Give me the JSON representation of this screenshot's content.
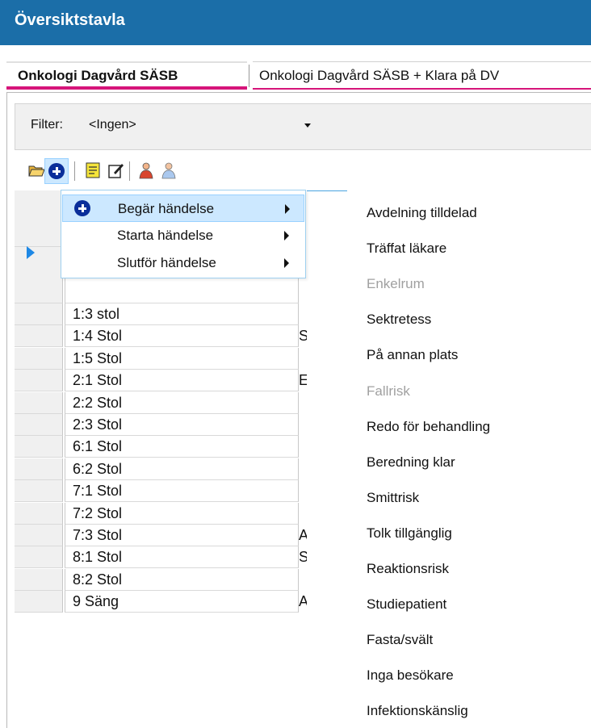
{
  "window": {
    "title": "Översiktstavla"
  },
  "tabs": [
    {
      "label": "Onkologi Dagvård SÄSB",
      "active": true
    },
    {
      "label": "Onkologi Dagvård SÄSB + Klara på DV",
      "active": false
    }
  ],
  "filter": {
    "label": "Filter:",
    "value": "<Ingen>"
  },
  "toolbar": {
    "icons": [
      "open-folder-icon",
      "add-event-icon",
      "note-icon",
      "edit-icon",
      "person-red-icon",
      "person-blue-icon"
    ]
  },
  "context_menu": {
    "items": [
      {
        "label": "Begär händelse",
        "highlighted": true
      },
      {
        "label": "Starta händelse",
        "highlighted": false
      },
      {
        "label": "Slutför händelse",
        "highlighted": false
      }
    ]
  },
  "submenu": {
    "items": [
      {
        "label": "Avdelning tilldelad",
        "enabled": true
      },
      {
        "label": "Träffat läkare",
        "enabled": true
      },
      {
        "label": "Enkelrum",
        "enabled": false
      },
      {
        "label": "Sektretess",
        "enabled": true
      },
      {
        "label": "På annan plats",
        "enabled": true
      },
      {
        "label": "Fallrisk",
        "enabled": false
      },
      {
        "label": "Redo för behandling",
        "enabled": true
      },
      {
        "label": "Beredning klar",
        "enabled": true
      },
      {
        "label": "Smittrisk",
        "enabled": true
      },
      {
        "label": "Tolk tillgänglig",
        "enabled": true
      },
      {
        "label": "Reaktionsrisk",
        "enabled": true
      },
      {
        "label": "Studiepatient",
        "enabled": true
      },
      {
        "label": "Fasta/svält",
        "enabled": true
      },
      {
        "label": "Inga besökare",
        "enabled": true
      },
      {
        "label": "Infektionskänslig",
        "enabled": true
      }
    ]
  },
  "grid": {
    "rows": [
      {
        "place": "1:3 stol",
        "next": ""
      },
      {
        "place": "1:4 Stol",
        "next": "S"
      },
      {
        "place": "1:5 Stol",
        "next": ""
      },
      {
        "place": "2:1 Stol",
        "next": "E"
      },
      {
        "place": "2:2 Stol",
        "next": ""
      },
      {
        "place": "2:3 Stol",
        "next": ""
      },
      {
        "place": "6:1 Stol",
        "next": ""
      },
      {
        "place": "6:2 Stol",
        "next": ""
      },
      {
        "place": "7:1 Stol",
        "next": ""
      },
      {
        "place": "7:2 Stol",
        "next": ""
      },
      {
        "place": "7:3 Stol",
        "next": "A"
      },
      {
        "place": "8:1 Stol",
        "next": "S"
      },
      {
        "place": "8:2 Stol",
        "next": ""
      },
      {
        "place": "9 Säng",
        "next": "A"
      }
    ]
  }
}
